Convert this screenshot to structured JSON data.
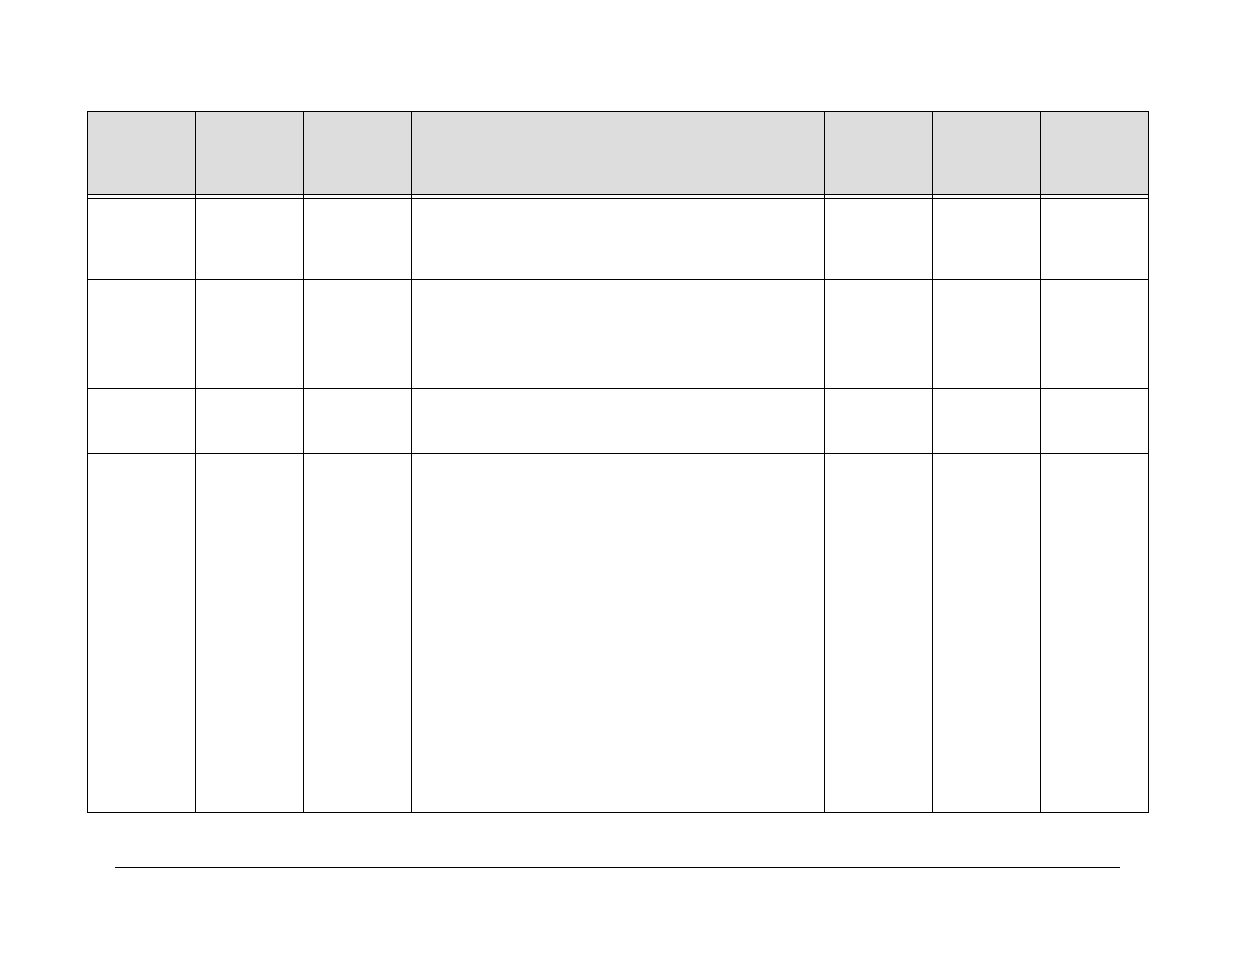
{
  "table": {
    "headers": [
      "",
      "",
      "",
      "",
      "",
      "",
      ""
    ],
    "rows": [
      [
        "",
        "",
        "",
        "",
        "",
        "",
        ""
      ],
      [
        "",
        "",
        "",
        "",
        "",
        "",
        ""
      ],
      [
        "",
        "",
        "",
        "",
        "",
        "",
        ""
      ],
      [
        "",
        "",
        "",
        "",
        "",
        "",
        ""
      ]
    ]
  }
}
